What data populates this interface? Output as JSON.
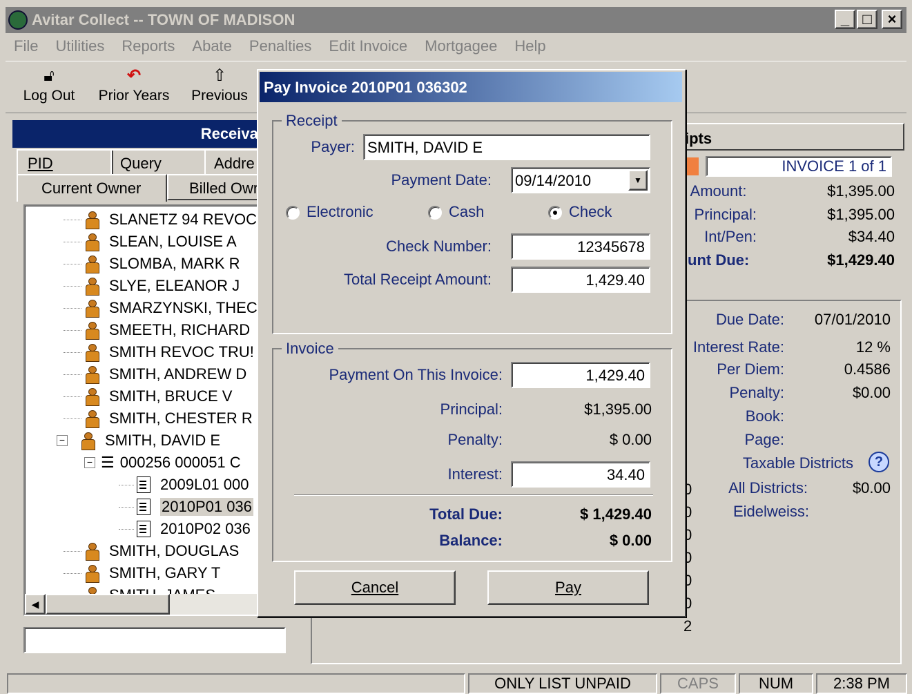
{
  "window": {
    "title": "Avitar Collect -- TOWN OF MADISON",
    "min": "_",
    "max": "□",
    "close": "×"
  },
  "menu": [
    "File",
    "Utilities",
    "Reports",
    "Abate",
    "Penalties",
    "Edit Invoice",
    "Mortgagee",
    "Help"
  ],
  "toolbar": {
    "logout": "Log Out",
    "prior_years": "Prior Years",
    "previous": "Previous"
  },
  "left": {
    "header": "Receival",
    "tabs_row1": [
      "PID",
      "Query",
      "Addre"
    ],
    "tabs_row2": [
      "Current Owner",
      "Billed Owr"
    ],
    "tree": [
      "SLANETZ 94 REVOC",
      "SLEAN, LOUISE A",
      "SLOMBA, MARK R",
      "SLYE, ELEANOR J",
      "SMARZYNSKI, THEC",
      "SMEETH, RICHARD",
      "SMITH REVOC TRU!",
      "SMITH, ANDREW D",
      "SMITH, BRUCE V",
      "SMITH, CHESTER R",
      "SMITH, DAVID E",
      "000256 000051 C",
      "2009L01 000",
      "2010P01 036",
      "2010P02 036",
      "SMITH, DOUGLAS",
      "SMITH, GARY T",
      "SMITH, JAMES"
    ],
    "expand_minus": "−"
  },
  "right": {
    "tab": "ipts",
    "invoice_label": "INVOICE 1 of 1",
    "summary": [
      {
        "label": "ill Amount:",
        "value": "$1,395.00"
      },
      {
        "label": "Principal:",
        "value": "$1,395.00"
      },
      {
        "label": "Int/Pen:",
        "value": "$34.40"
      },
      {
        "label": "unt Due:",
        "value": "$1,429.40"
      }
    ],
    "details": [
      {
        "label": "Due Date:",
        "value": "07/01/2010"
      },
      {
        "label": "Interest Rate:",
        "value": "12 %"
      },
      {
        "label": "Per Diem:",
        "value": "0.4586"
      },
      {
        "label": "Penalty:",
        "value": "$0.00"
      },
      {
        "label": "Book:",
        "value": ""
      },
      {
        "label": "Page:",
        "value": ""
      }
    ],
    "taxable_districts": "Taxable Districts",
    "all_districts": "All Districts:",
    "all_districts_value": "$0.00",
    "eidelweiss": "Eidelweiss:",
    "col_digits": [
      "0",
      "0",
      "0",
      "0",
      "0",
      "0",
      "2"
    ]
  },
  "dialog": {
    "title": "Pay Invoice 2010P01 036302",
    "receipt_group": "Receipt",
    "payer_label": "Payer:",
    "payer": "SMITH, DAVID E",
    "payment_date_label": "Payment Date:",
    "payment_date": "09/14/2010",
    "radios": [
      "Electronic",
      "Cash",
      "Check"
    ],
    "selected": "Check",
    "check_number_label": "Check Number:",
    "check_number": "12345678",
    "total_receipt_label": "Total Receipt Amount:",
    "total_receipt": "1,429.40",
    "invoice_group": "Invoice",
    "payment_label": "Payment On This Invoice:",
    "payment": "1,429.40",
    "principal_label": "Principal:",
    "principal": "$1,395.00",
    "penalty_label": "Penalty:",
    "penalty": "$ 0.00",
    "interest_label": "Interest:",
    "interest": "34.40",
    "total_due_label": "Total Due:",
    "total_due": "$ 1,429.40",
    "balance_label": "Balance:",
    "balance": "$ 0.00",
    "cancel": "Cancel",
    "pay": "Pay"
  },
  "status": {
    "only_unpaid": "ONLY LIST UNPAID",
    "caps": "CAPS",
    "num": "NUM",
    "time": "2:38 PM"
  }
}
